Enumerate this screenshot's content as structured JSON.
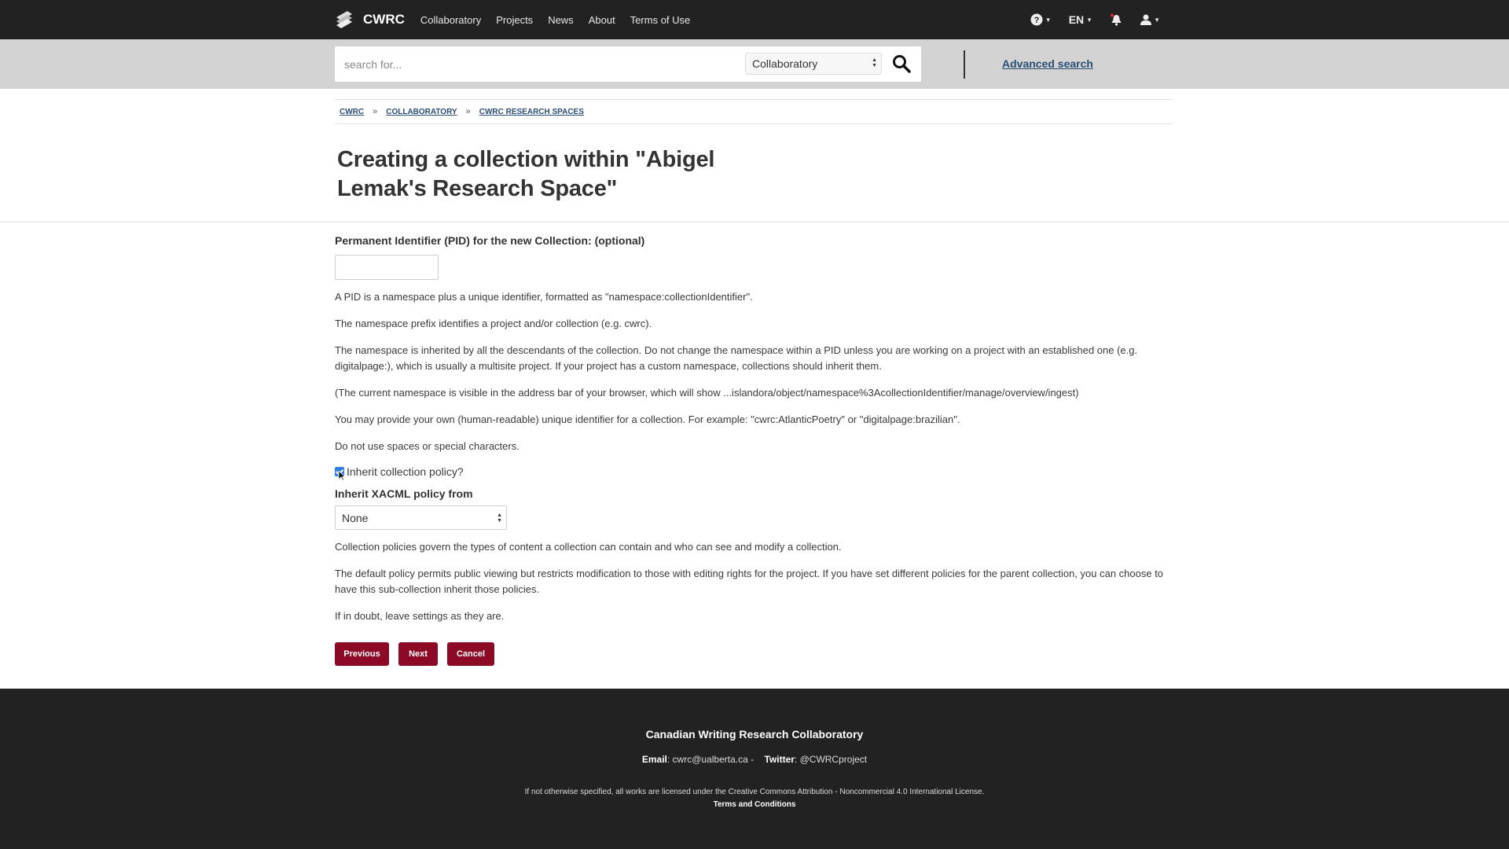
{
  "nav": {
    "brand": "CWRC",
    "links": [
      "Collaboratory",
      "Projects",
      "News",
      "About",
      "Terms of Use"
    ],
    "lang": "EN"
  },
  "search": {
    "placeholder": "search for...",
    "scope": "Collaboratory",
    "advanced": "Advanced search"
  },
  "breadcrumb": [
    "CWRC",
    "COLLABORATORY",
    "CWRC RESEARCH SPACES"
  ],
  "page": {
    "title": "Creating a collection within \"Abigel Lemak's Research Space\""
  },
  "form": {
    "pid_label": "Permanent Identifier (PID) for the new Collection: (optional)",
    "pid_value": "",
    "help": [
      "A PID is a namespace plus a unique identifier, formatted as \"namespace:collectionIdentifier\".",
      "The namespace prefix identifies a project and/or collection (e.g. cwrc).",
      "The namespace is inherited by all the descendants of the collection. Do not change the namespace within a PID unless you are working on a project with an established one (e.g. digitalpage:), which is usually a multisite project. If your project has a custom namespace, collections should inherit them.",
      "(The current namespace is visible in the address bar of your browser, which will show ...islandora/object/namespace%3AcollectionIdentifier/manage/overview/ingest)",
      "You may provide your own (human-readable) unique identifier for a collection. For example: \"cwrc:AtlanticPoetry\" or \"digitalpage:brazilian\".",
      "Do not use spaces or special characters."
    ],
    "inherit_checkbox_label": "Inherit collection policy?",
    "inherit_checked": true,
    "xacml_label": "Inherit XACML policy from",
    "xacml_selected": "None",
    "policy_help": [
      "Collection policies govern the types of content a collection can contain and who can see and modify a collection.",
      "The default policy permits public viewing but restricts modification to those with editing rights for the project. If you have set different policies for the parent collection, you can choose to have this sub-collection inherit those policies.",
      "If in doubt, leave settings as they are."
    ],
    "buttons": {
      "previous": "Previous",
      "next": "Next",
      "cancel": "Cancel"
    }
  },
  "footer": {
    "org": "Canadian Writing Research Collaboratory",
    "email_label": "Email",
    "email": ": cwrc@ualberta.ca - ",
    "twitter_label": "Twitter",
    "twitter": ": @CWRCproject",
    "license": "If not otherwise specified, all works are licensed under the Creative Commons Attribution - Noncommercial 4.0 International License.",
    "terms": "Terms and Conditions"
  },
  "colors": {
    "nav_bg": "#222222",
    "search_bg": "#d3d3d3",
    "button_red": "#8c0a25",
    "link_blue": "#2a4d74",
    "checkbox_blue": "#2f7ae5"
  }
}
